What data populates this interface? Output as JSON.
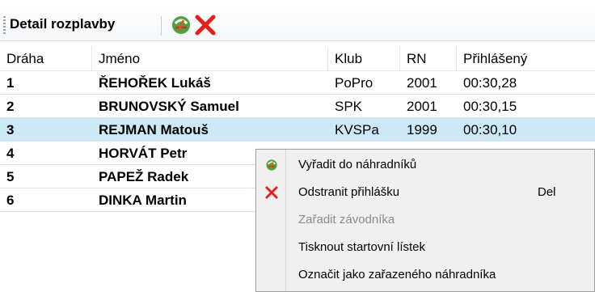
{
  "toolbar": {
    "title": "Detail rozplavby",
    "icons": [
      "assign-to-reserves-icon",
      "delete-icon"
    ]
  },
  "grid": {
    "columns": [
      "Dráha",
      "Jméno",
      "Klub",
      "RN",
      "Přihlášený"
    ],
    "rows": [
      {
        "lane": "1",
        "name": "ŘEHOŘEK Lukáš",
        "club": "PoPro",
        "year": "2001",
        "entry": "00:30,28"
      },
      {
        "lane": "2",
        "name": "BRUNOVSKÝ Samuel",
        "club": "SPK",
        "year": "2001",
        "entry": "00:30,15"
      },
      {
        "lane": "3",
        "name": "REJMAN Matouš",
        "club": "KVSPa",
        "year": "1999",
        "entry": "00:30,10",
        "selected": true
      },
      {
        "lane": "4",
        "name": "HORVÁT Petr",
        "club": "",
        "year": "",
        "entry": ""
      },
      {
        "lane": "5",
        "name": "PAPEŽ Radek",
        "club": "",
        "year": "",
        "entry": ""
      },
      {
        "lane": "6",
        "name": "DINKA Martin",
        "club": "",
        "year": "",
        "entry": ""
      }
    ]
  },
  "context_menu": {
    "items": [
      {
        "label": "Vyřadit do náhradníků",
        "icon": "assign-to-reserves-icon",
        "shortcut": "",
        "enabled": true
      },
      {
        "label": "Odstranit přihlášku",
        "icon": "delete-icon",
        "shortcut": "Del",
        "enabled": true
      },
      {
        "label": "Zařadit závodníka",
        "icon": "",
        "shortcut": "",
        "enabled": false
      },
      {
        "label": "Tisknout startovní lístek",
        "icon": "",
        "shortcut": "",
        "enabled": true
      },
      {
        "label": "Označit jako zařazeného náhradníka",
        "icon": "",
        "shortcut": "",
        "enabled": true
      }
    ]
  },
  "colors": {
    "selection": "#cde8f7",
    "delete_red": "#e3201b",
    "reserve_green": "#3c9a2f"
  }
}
